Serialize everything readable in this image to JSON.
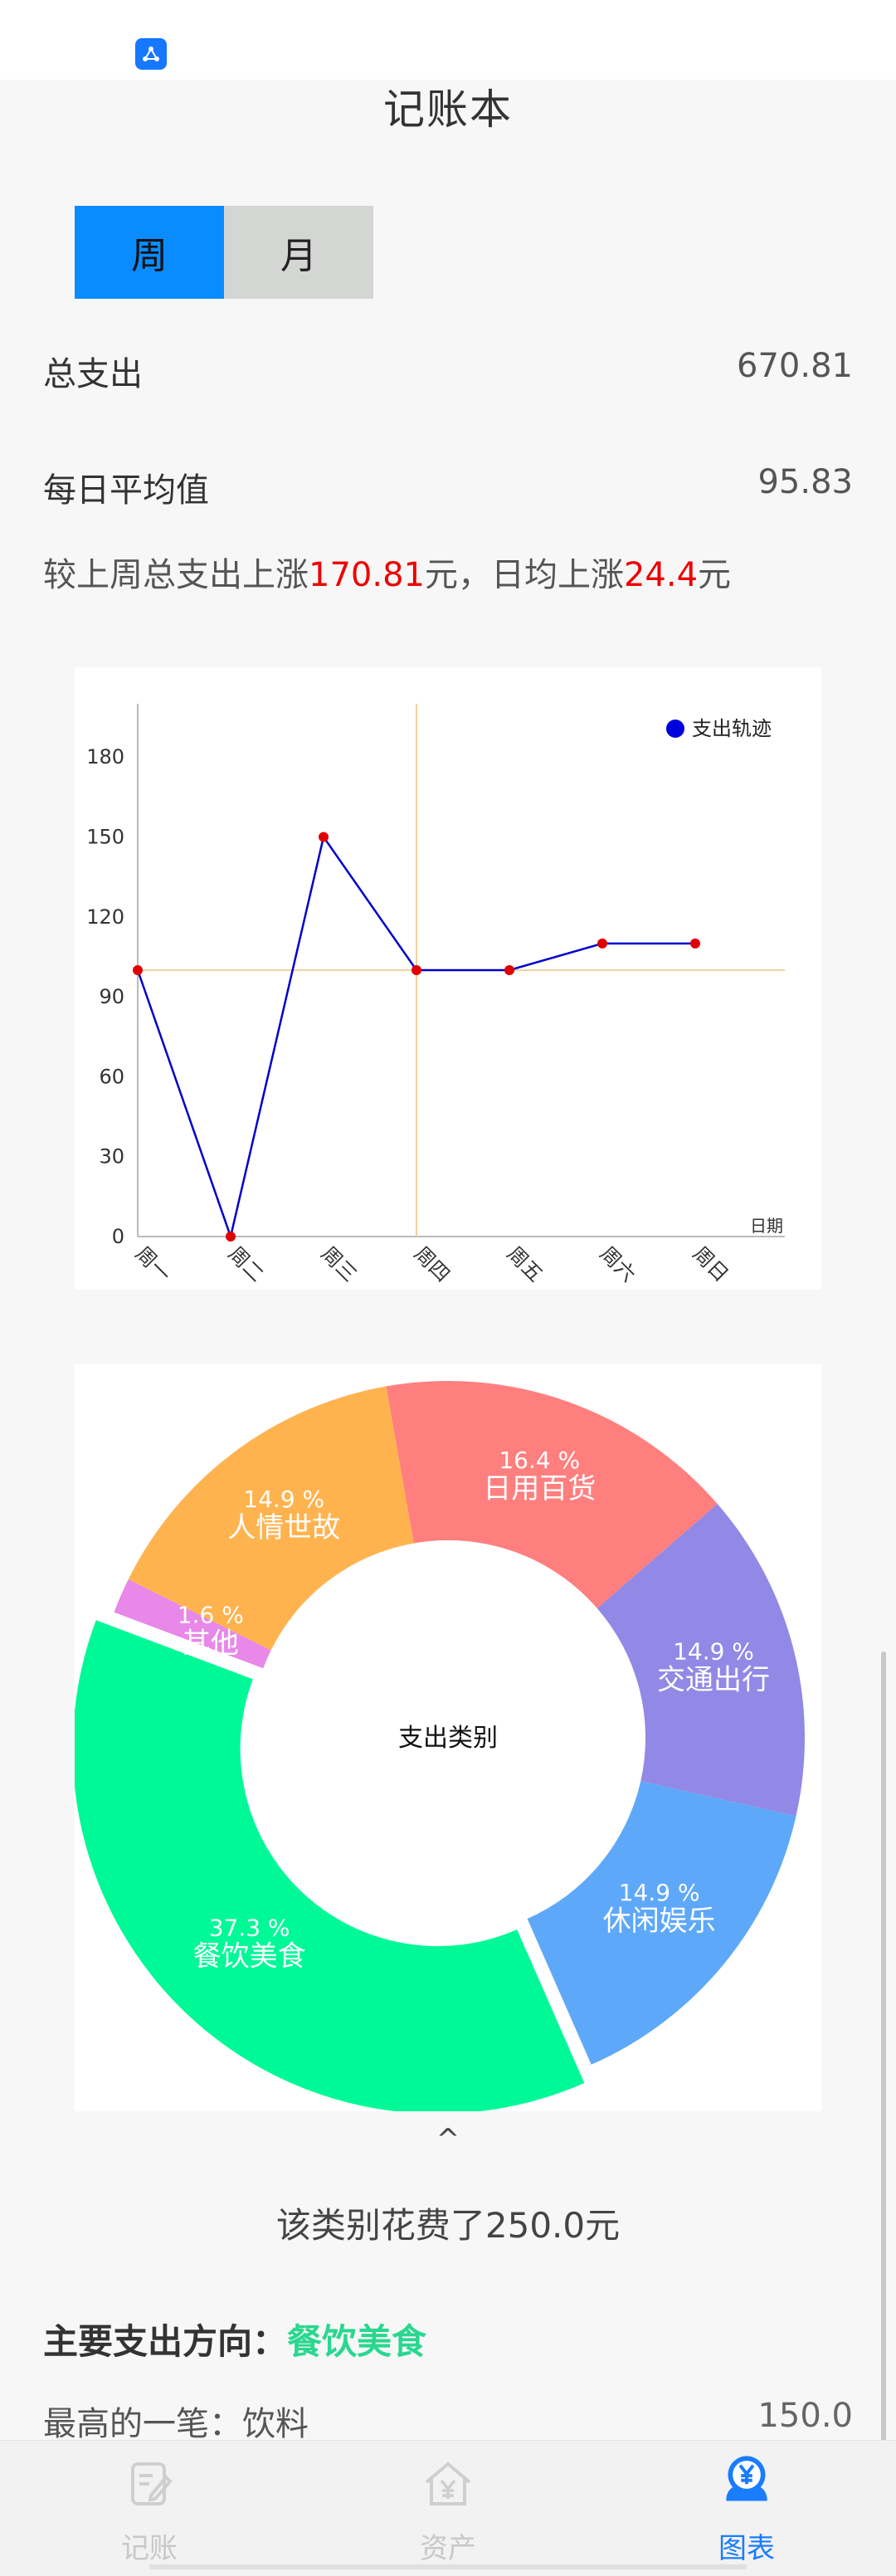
{
  "app": {
    "title": "记账本"
  },
  "period_tabs": [
    {
      "label": "周",
      "active": true
    },
    {
      "label": "月",
      "active": false
    }
  ],
  "summary": {
    "total_label": "总支出",
    "total_value": "670.81",
    "avg_label": "每日平均值",
    "avg_value": "95.83",
    "compare_prefix": "较上周总支出上涨",
    "compare_total": "170.81",
    "compare_mid": "元，日均上涨",
    "compare_avg": "24.4",
    "compare_suffix": "元"
  },
  "chart_data": [
    {
      "type": "line",
      "categories": [
        "周一",
        "周二",
        "周三",
        "周四",
        "周五",
        "周六",
        "周日"
      ],
      "series": [
        {
          "name": "支出轨迹",
          "values": [
            100,
            0,
            150,
            100,
            100,
            110,
            110
          ]
        }
      ],
      "y_ticks": [
        0,
        30,
        60,
        90,
        120,
        150,
        180
      ],
      "ylim": [
        0,
        200
      ],
      "xlabel": "日期",
      "legend": "top-right",
      "marked_category": "周四",
      "marked_value": 100,
      "colors": {
        "line": "#0000cc",
        "point": "#e00000",
        "crosshair": "#f0d2a0",
        "legend_dot": "#0000dd"
      }
    },
    {
      "type": "pie",
      "center_label": "支出类别",
      "slices": [
        {
          "label": "日用百货",
          "percent_label": "16.4 %",
          "value": 16.4,
          "color": "#ff7f7f"
        },
        {
          "label": "交通出行",
          "percent_label": "14.9 %",
          "value": 14.9,
          "color": "#9189e5"
        },
        {
          "label": "休闲娱乐",
          "percent_label": "14.9 %",
          "value": 14.9,
          "color": "#5ea8f9"
        },
        {
          "label": "餐饮美食",
          "percent_label": "37.3 %",
          "value": 37.3,
          "color": "#00f997",
          "selected": true
        },
        {
          "label": "其他",
          "percent_label": "1.6 %",
          "value": 1.6,
          "color": "#e888e8"
        },
        {
          "label": "人情世故",
          "percent_label": "14.9 %",
          "value": 14.9,
          "color": "#ffb34f"
        }
      ]
    }
  ],
  "selected_category": {
    "caret": "^",
    "text": "该类别花费了250.0元"
  },
  "main_direction": {
    "label": "主要支出方向：",
    "value": "餐饮美食"
  },
  "max_expense": {
    "label": "最高的一笔：饮料",
    "value": "150.0"
  },
  "tabbar": [
    {
      "label": "记账",
      "icon": "note-edit-icon",
      "active": false
    },
    {
      "label": "资产",
      "icon": "yuan-house-icon",
      "active": false
    },
    {
      "label": "图表",
      "icon": "yuan-badge-icon",
      "active": true
    }
  ],
  "colors": {
    "accent": "#0a8cff",
    "red": "#ee0000",
    "green": "#2ad78f",
    "tab_active": "#1a7cff"
  }
}
